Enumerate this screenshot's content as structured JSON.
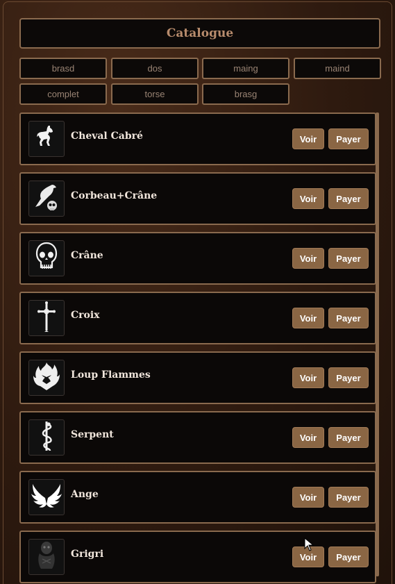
{
  "header": {
    "title": "Catalogue"
  },
  "filters": [
    "brasd",
    "dos",
    "maing",
    "maind",
    "complet",
    "torse",
    "brasg"
  ],
  "actions": {
    "view_label": "Voir",
    "pay_label": "Payer"
  },
  "items": [
    {
      "name": "Cheval Cabré",
      "icon": "horse-icon"
    },
    {
      "name": "Corbeau+Crâne",
      "icon": "raven-skull-icon"
    },
    {
      "name": "Crâne",
      "icon": "skull-icon"
    },
    {
      "name": "Croix",
      "icon": "cross-icon"
    },
    {
      "name": "Loup Flammes",
      "icon": "wolf-flames-icon"
    },
    {
      "name": "Serpent",
      "icon": "serpent-icon"
    },
    {
      "name": "Ange",
      "icon": "wings-icon"
    },
    {
      "name": "Grigri",
      "icon": "grigri-icon"
    }
  ],
  "colors": {
    "accent": "#8a6644",
    "border": "#8a6a4e",
    "title": "#b78b6c",
    "panel": "#0b0807"
  }
}
